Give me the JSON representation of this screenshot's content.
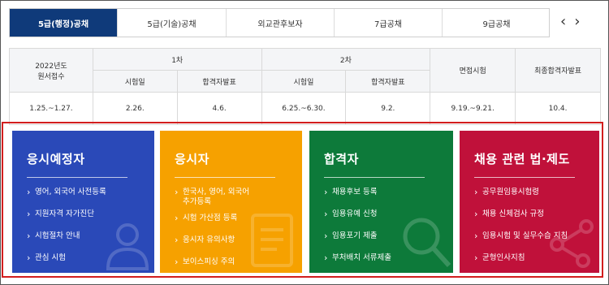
{
  "tabs": [
    {
      "label": "5급(행정)공채",
      "active": true
    },
    {
      "label": "5급(기술)공채",
      "active": false
    },
    {
      "label": "외교관후보자",
      "active": false
    },
    {
      "label": "7급공채",
      "active": false
    },
    {
      "label": "9급공채",
      "active": false
    },
    {
      "label": "",
      "active": false
    }
  ],
  "nav": {
    "prev": "‹",
    "next": "›"
  },
  "schedule": {
    "header": {
      "apply": "2022년도\n원서접수",
      "stage1": "1차",
      "stage2": "2차",
      "interview": "면접시험",
      "final": "최종합격자발표",
      "exam_date": "시험일",
      "pass_announce": "합격자발표"
    },
    "row": {
      "apply": "1.25.~1.27.",
      "s1_exam": "2.26.",
      "s1_pass": "4.6.",
      "s2_exam": "6.25.~6.30.",
      "s2_pass": "9.2.",
      "interview": "9.19.~9.21.",
      "final": "10.4."
    }
  },
  "cards": [
    {
      "title": "응시예정자",
      "color": "#2a49b8",
      "icon": "person-icon",
      "items": [
        "영어, 외국어 사전등록",
        "지원자격 자가진단",
        "시험절차 안내",
        "관심 시험"
      ]
    },
    {
      "title": "응시자",
      "color": "#f6a100",
      "icon": "document-icon",
      "items": [
        "한국사, 영어, 외국어\n추가등록",
        "시험 가산점 등록",
        "응시자 유의사항",
        "보이스피싱 주의"
      ]
    },
    {
      "title": "합격자",
      "color": "#0d7a3a",
      "icon": "magnifier-icon",
      "items": [
        "채용후보 등록",
        "임용유예 신청",
        "임용포기 제출",
        "부처배치 서류제출"
      ]
    },
    {
      "title": "채용 관련 법·제도",
      "color": "#c0113a",
      "icon": "network-icon",
      "items": [
        "공무원임용시험령",
        "채용 신체검사 규정",
        "임용시험 및 실무수습 지침",
        "균형인사지침"
      ]
    }
  ]
}
